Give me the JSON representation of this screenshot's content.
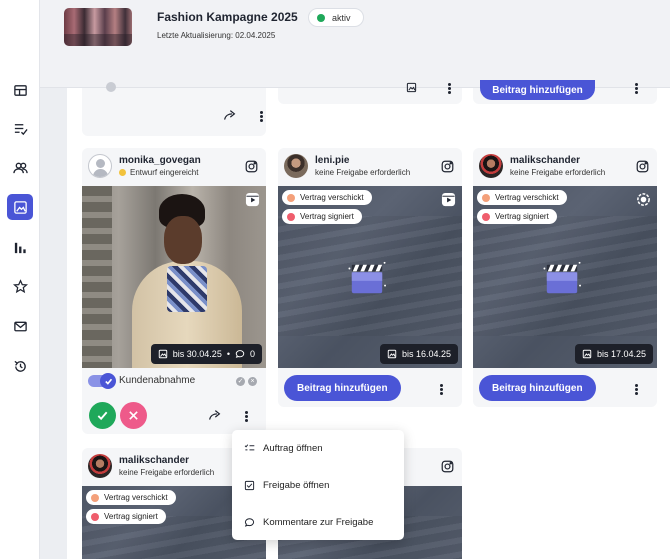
{
  "campaign": {
    "title": "Fashion Kampagne 2025",
    "status": "aktiv",
    "updated": "Letzte Aktualisierung: 02.04.2025"
  },
  "nav": [
    "table-icon",
    "checklist-icon",
    "users-icon",
    "image-icon",
    "bar-chart-icon",
    "star-icon",
    "mail-icon",
    "history-icon"
  ],
  "top_row": {
    "add_label": "Beitrag hinzufügen"
  },
  "cards": [
    {
      "user": "monika_govegan",
      "status": "Entwurf eingereicht",
      "date": "bis 30.04.25",
      "comments": "0",
      "approval_label": "Kundenabnahme"
    },
    {
      "user": "leni.pie",
      "status": "keine Freigabe erforderlich",
      "tags": [
        "Vertrag verschickt",
        "Vertrag signiert"
      ],
      "date": "bis 16.04.25",
      "add_label": "Beitrag hinzufügen"
    },
    {
      "user": "malikschander",
      "status": "keine Freigabe erforderlich",
      "tags": [
        "Vertrag verschickt",
        "Vertrag signiert"
      ],
      "date": "bis 17.04.25",
      "add_label": "Beitrag hinzufügen"
    },
    {
      "user": "malikschander",
      "status": "keine Freigabe erforderlich",
      "tags": [
        "Vertrag verschickt",
        "Vertrag signiert"
      ]
    }
  ],
  "menu": [
    "Auftrag öffnen",
    "Freigabe öffnen",
    "Kommentare zur Freigabe"
  ],
  "colors": {
    "accent": "#4a55d6",
    "active_status": "#1fa85a",
    "tag_sent": "#f4a07a",
    "tag_signed": "#ef5d6c",
    "draft": "#f2c23c"
  }
}
